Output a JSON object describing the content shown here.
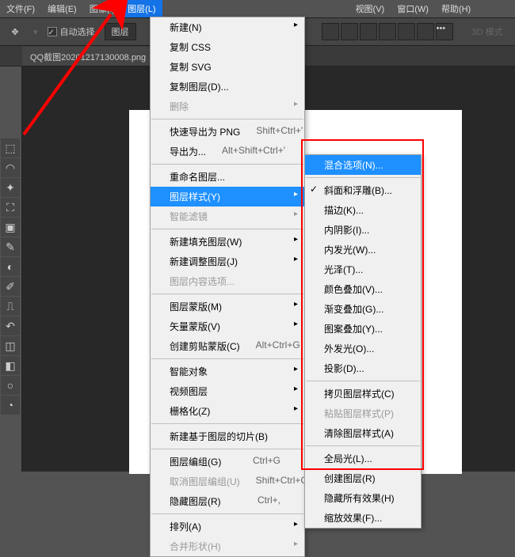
{
  "menubar": {
    "file": "文件(F)",
    "edit": "编辑(E)",
    "image": "图像(I)",
    "layer": "图层(L)",
    "view": "视图(V)",
    "window": "窗口(W)",
    "help": "帮助(H)"
  },
  "toolbar": {
    "auto_select": "自动选择",
    "layer_dd": "图层",
    "mode3d": "3D 模式"
  },
  "tab": {
    "name": "QQ截图20201217130008.png"
  },
  "menu": {
    "new": "新建(N)",
    "copy_css": "复制 CSS",
    "copy_svg": "复制 SVG",
    "dup_layer": "复制图层(D)...",
    "delete": "删除",
    "quick_export": "快速导出为 PNG",
    "quick_export_sc": "Shift+Ctrl+'",
    "export_as": "导出为...",
    "export_as_sc": "Alt+Shift+Ctrl+'",
    "rename": "重命名图层...",
    "layer_style": "图层样式(Y)",
    "smart_filter": "智能滤镜",
    "new_fill": "新建填充图层(W)",
    "new_adj": "新建调整图层(J)",
    "layer_content": "图层内容选项...",
    "layer_mask": "图层蒙版(M)",
    "vector_mask": "矢量蒙版(V)",
    "clip_mask": "创建剪贴蒙版(C)",
    "clip_mask_sc": "Alt+Ctrl+G",
    "smart_obj": "智能对象",
    "video_layer": "视频图层",
    "rasterize": "栅格化(Z)",
    "new_slice": "新建基于图层的切片(B)",
    "group": "图层编组(G)",
    "group_sc": "Ctrl+G",
    "ungroup": "取消图层编组(U)",
    "ungroup_sc": "Shift+Ctrl+G",
    "hide": "隐藏图层(R)",
    "hide_sc": "Ctrl+,",
    "arrange": "排列(A)",
    "combine": "合并形状(H)"
  },
  "submenu": {
    "blend_options": "混合选项(N)...",
    "bevel": "斜面和浮雕(B)...",
    "stroke": "描边(K)...",
    "inner_shadow": "内阴影(I)...",
    "inner_glow": "内发光(W)...",
    "satin": "光泽(T)...",
    "color_overlay": "颜色叠加(V)...",
    "gradient_overlay": "渐变叠加(G)...",
    "pattern_overlay": "图案叠加(Y)...",
    "outer_glow": "外发光(O)...",
    "drop_shadow": "投影(D)...",
    "copy_style": "拷贝图层样式(C)",
    "paste_style": "粘贴图层样式(P)",
    "clear_style": "清除图层样式(A)",
    "global_light": "全局光(L)...",
    "create_layer": "创建图层(R)",
    "hide_effects": "隐藏所有效果(H)",
    "scale_effects": "缩放效果(F)..."
  }
}
